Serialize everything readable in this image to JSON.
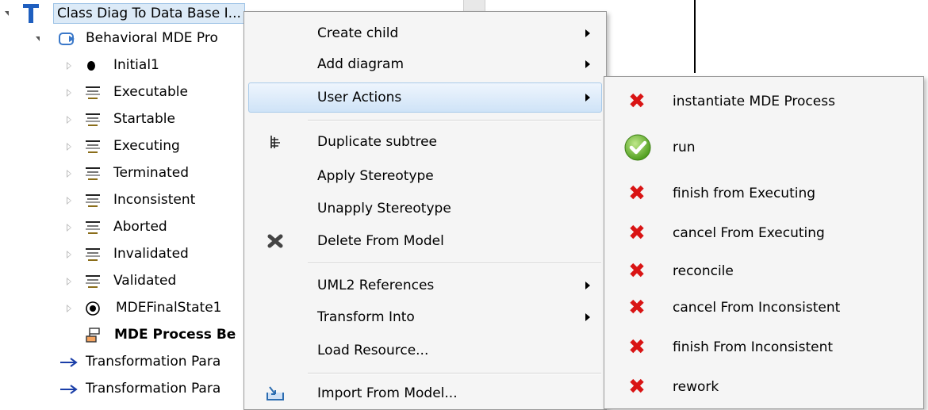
{
  "tree": {
    "root_label": "Class Diag To Data Base I...",
    "process_label": "Behavioral MDE Pro",
    "children": [
      {
        "label": "Initial1",
        "icon": "initial-node-icon"
      },
      {
        "label": "Executable",
        "icon": "state-icon"
      },
      {
        "label": "Startable",
        "icon": "state-icon"
      },
      {
        "label": "Executing",
        "icon": "state-icon"
      },
      {
        "label": "Terminated",
        "icon": "state-icon"
      },
      {
        "label": "Inconsistent",
        "icon": "state-icon"
      },
      {
        "label": "Aborted",
        "icon": "state-icon"
      },
      {
        "label": "Invalidated",
        "icon": "state-icon"
      },
      {
        "label": "Validated",
        "icon": "state-icon"
      },
      {
        "label": "MDEFinalState1",
        "icon": "final-state-icon"
      }
    ],
    "behavior_label": "MDE Process Be",
    "param_labels": [
      "Transformation Para",
      "Transformation Para"
    ]
  },
  "menu": {
    "create_child": "Create child",
    "add_diagram": "Add diagram",
    "user_actions": "User Actions",
    "duplicate_subtree": "Duplicate subtree",
    "apply_stereotype": "Apply Stereotype",
    "unapply_stereotype": "Unapply Stereotype",
    "delete_from_model": "Delete From Model",
    "uml2_references": "UML2 References",
    "transform_into": "Transform Into",
    "load_resource": "Load Resource...",
    "import_from_model": "Import From Model..."
  },
  "submenu": {
    "items": [
      {
        "label": "instantiate MDE Process",
        "enabled": false
      },
      {
        "label": "run",
        "enabled": true
      },
      {
        "label": "finish from Executing",
        "enabled": false
      },
      {
        "label": "cancel From Executing",
        "enabled": false
      },
      {
        "label": "reconcile",
        "enabled": false
      },
      {
        "label": "cancel From Inconsistent",
        "enabled": false
      },
      {
        "label": "finish From Inconsistent",
        "enabled": false
      },
      {
        "label": "rework",
        "enabled": false
      }
    ]
  },
  "colors": {
    "highlight": "#cfe3f7",
    "disabled_mark": "#d91414",
    "enabled_mark": "#5fb52a",
    "link_arrow": "#1a3ea8"
  }
}
